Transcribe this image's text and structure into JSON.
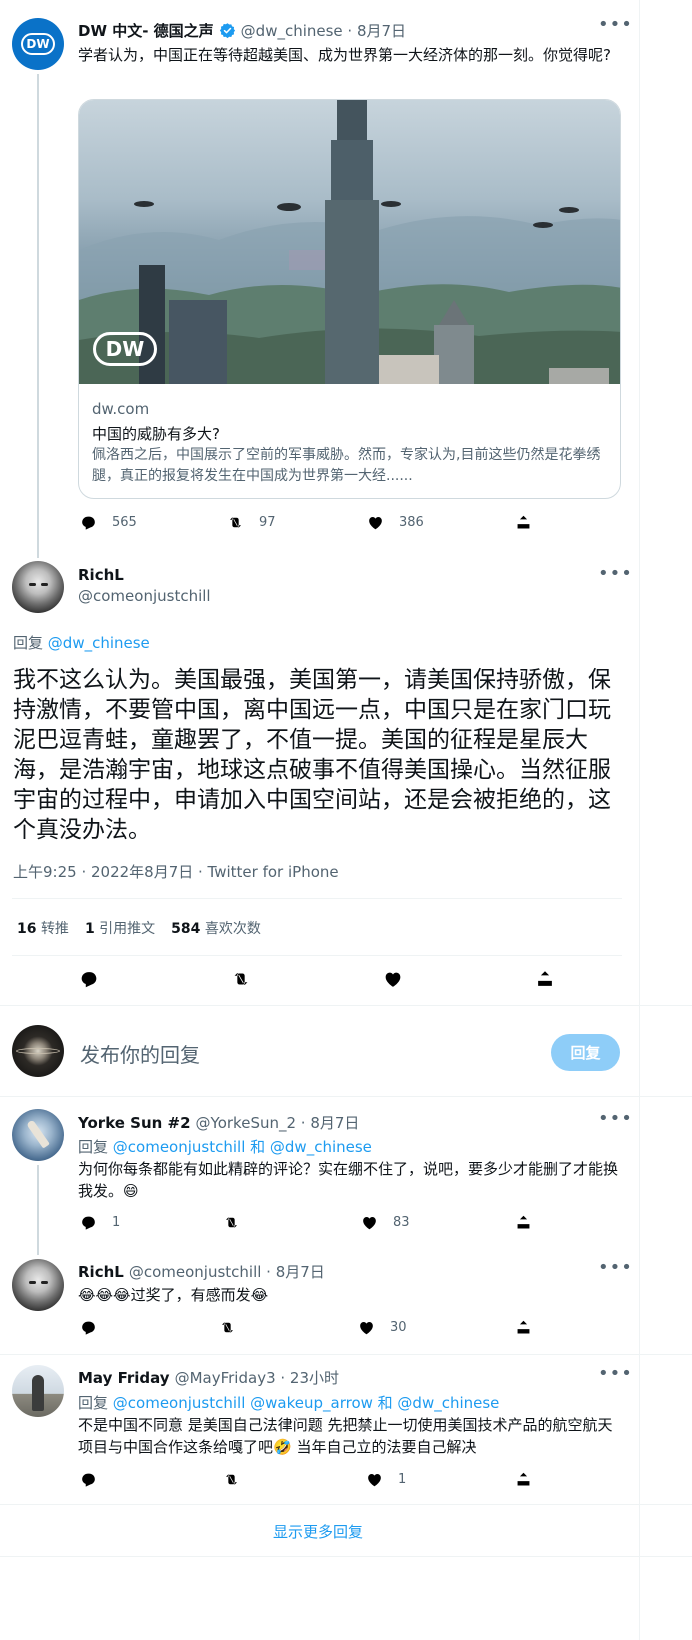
{
  "quoted_tweet": {
    "author_name": "DW 中文- 德国之声",
    "handle_time": "@dw_chinese · 8月7日",
    "text": "学者认为，中国正在等待超越美国、成为世界第一大经济体的那一刻。你觉得呢?",
    "avatar_label": "DW",
    "card": {
      "logo_label": "DW",
      "domain": "dw.com",
      "title": "中国的威胁有多大?",
      "description": "佩洛西之后，中国展示了空前的军事威胁。然而，专家认为,目前这些仍然是花拳绣腿，真正的报复将发生在中国成为世界第一大经......"
    },
    "actions": {
      "replies": "565",
      "retweets": "97",
      "likes": "386"
    }
  },
  "main_tweet": {
    "author_name": "RichL",
    "handle": "@comeonjustchill",
    "reply_prefix": "回复",
    "reply_to": "@dw_chinese",
    "text": "我不这么认为。美国最强，美国第一，请美国保持骄傲，保持激情，不要管中国，离中国远一点，中国只是在家门口玩泥巴逗青蛙，童趣罢了，不值一提。美国的征程是星辰大海，是浩瀚宇宙，地球这点破事不值得美国操心。当然征服宇宙的过程中，申请加入中国空间站，还是会被拒绝的，这个真没办法。",
    "timestamp": "上午9:25 · 2022年8月7日 · Twitter for iPhone",
    "stats": {
      "retweets_count": "16",
      "retweets_label": "转推",
      "quotes_count": "1",
      "quotes_label": "引用推文",
      "likes_count": "584",
      "likes_label": "喜欢次数"
    }
  },
  "compose": {
    "placeholder": "发布你的回复",
    "button_label": "回复"
  },
  "replies": [
    {
      "author_name": "Yorke Sun #2",
      "handle_time": "@YorkeSun_2 · 8月7日",
      "reply_prefix": "回复",
      "reply_to": "@comeonjustchill 和 @dw_chinese",
      "text": "为何你每条都能有如此精辟的评论？实在绷不住了，说吧，要多少才能删了才能换我发。😄",
      "actions": {
        "replies": "1",
        "retweets": "",
        "likes": "83"
      }
    },
    {
      "author_name": "RichL",
      "handle_time": "@comeonjustchill · 8月7日",
      "text": "😂😂😂过奖了，有感而发😂",
      "actions": {
        "replies": "",
        "retweets": "",
        "likes": "30"
      }
    },
    {
      "author_name": "May Friday",
      "handle_time": "@MayFriday3 · 23小时",
      "reply_prefix": "回复",
      "reply_to": "@comeonjustchill @wakeup_arrow 和 @dw_chinese",
      "text": "不是中国不同意 是美国自己法律问题 先把禁止一切使用美国技术产品的航空航天项目与中国合作这条给嘎了吧🤣 当年自己立的法要自己解决",
      "actions": {
        "replies": "",
        "retweets": "",
        "likes": "1"
      }
    }
  ],
  "show_more_label": "显示更多回复",
  "colors": {
    "accent": "#1d9bf0",
    "muted": "#536471",
    "button_disabled": "#8ecdf8",
    "dw_blue": "#0a72c8"
  },
  "icons": [
    "more-icon",
    "verified-icon",
    "reply-icon",
    "retweet-icon",
    "like-icon",
    "share-icon"
  ]
}
